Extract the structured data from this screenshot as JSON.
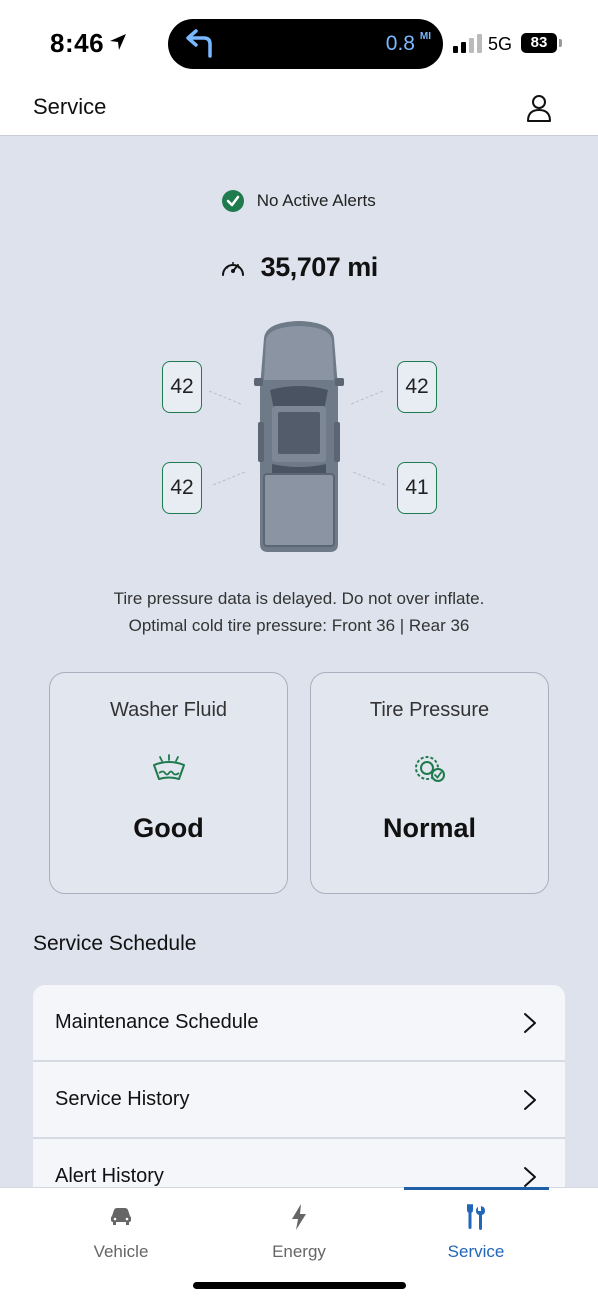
{
  "status_bar": {
    "time": "8:46",
    "nav_distance": "0.8",
    "nav_distance_unit": "MI",
    "network": "5G",
    "battery": "83"
  },
  "header": {
    "title": "Service",
    "profile_icon": "person-icon"
  },
  "alerts": {
    "status_text": "No Active Alerts",
    "status_icon": "check-circle-icon",
    "status_color": "#1f7a4d"
  },
  "odometer": {
    "value": "35,707 mi",
    "icon": "speedometer-icon"
  },
  "tires": {
    "front_left": "42",
    "front_right": "42",
    "rear_left": "42",
    "rear_right": "41"
  },
  "tire_note": {
    "line1": "Tire pressure data is delayed. Do not over inflate.",
    "line2": "Optimal cold tire pressure: Front 36 | Rear 36"
  },
  "cards": [
    {
      "title": "Washer Fluid",
      "icon": "windshield-washer-icon",
      "value": "Good"
    },
    {
      "title": "Tire Pressure",
      "icon": "tire-pressure-icon",
      "value": "Normal"
    }
  ],
  "schedule": {
    "title": "Service Schedule",
    "items": [
      {
        "label": "Maintenance Schedule"
      },
      {
        "label": "Service History"
      },
      {
        "label": "Alert History"
      }
    ]
  },
  "bottom_nav": {
    "items": [
      {
        "label": "Vehicle",
        "icon": "car-icon"
      },
      {
        "label": "Energy",
        "icon": "lightning-icon"
      },
      {
        "label": "Service",
        "icon": "tools-icon"
      }
    ],
    "active": "Service",
    "active_color": "#2266b8"
  }
}
